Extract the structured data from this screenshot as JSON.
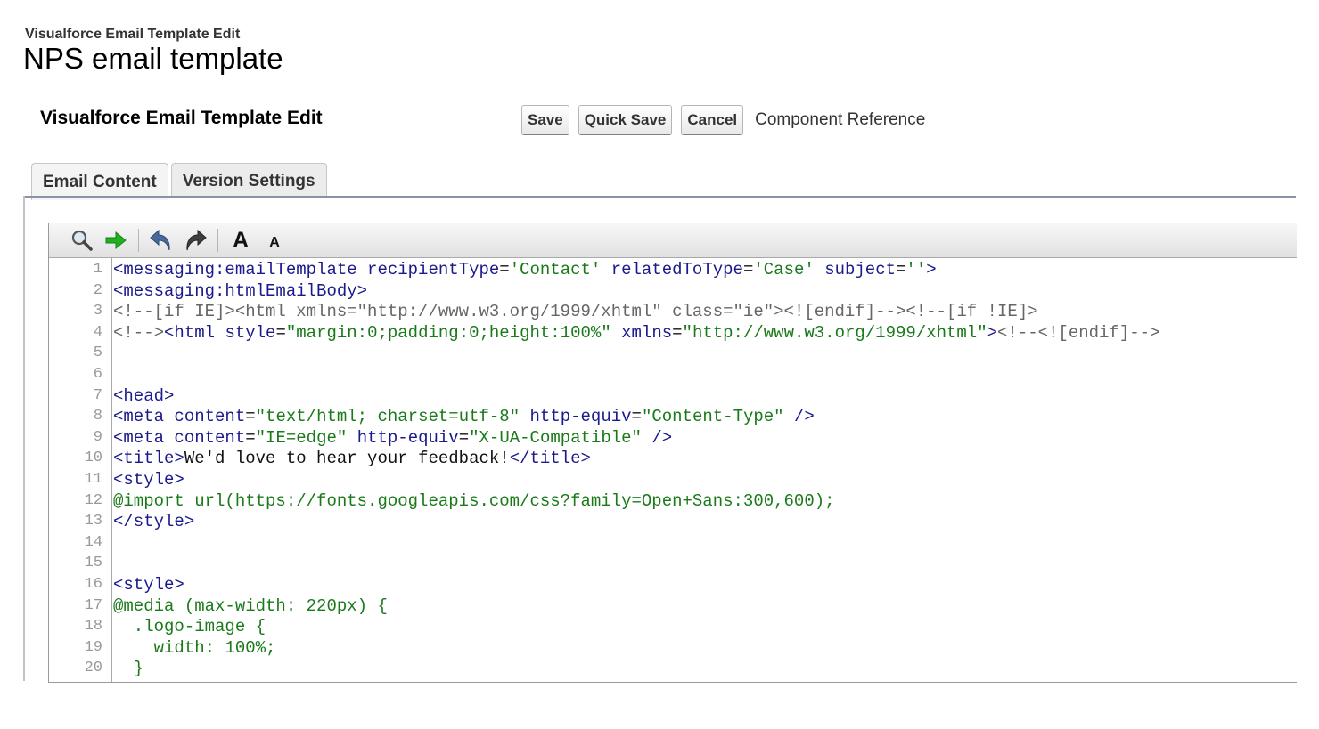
{
  "header": {
    "page_type": "Visualforce Email Template Edit",
    "page_title": "NPS email template",
    "section_title": "Visualforce Email Template Edit"
  },
  "buttons": {
    "save": "Save",
    "quick_save": "Quick Save",
    "cancel": "Cancel",
    "component_reference": "Component Reference"
  },
  "tabs": [
    {
      "label": "Email Content",
      "active": true
    },
    {
      "label": "Version Settings",
      "active": false
    }
  ],
  "toolbar": {
    "icons": [
      "search-icon",
      "go-to-line-icon",
      "undo-icon",
      "redo-icon",
      "increase-font-icon",
      "decrease-font-icon"
    ],
    "increase_font_label": "A",
    "decrease_font_label": "A"
  },
  "colors": {
    "tag": "#1a1a8c",
    "value": "#1a7a1a",
    "comment": "#666666",
    "tab_underline": "#8a93a8"
  },
  "code_lines": [
    {
      "num": "1",
      "segs": [
        [
          "t-tag",
          "<messaging:emailTemplate "
        ],
        [
          "t-att",
          "recipientType"
        ],
        [
          "t-black",
          "="
        ],
        [
          "t-val",
          "'Contact'"
        ],
        [
          "t-black",
          " "
        ],
        [
          "t-att",
          "relatedToType"
        ],
        [
          "t-black",
          "="
        ],
        [
          "t-val",
          "'Case'"
        ],
        [
          "t-black",
          " "
        ],
        [
          "t-att",
          "subject"
        ],
        [
          "t-black",
          "="
        ],
        [
          "t-val",
          "''"
        ],
        [
          "t-tag",
          ">"
        ]
      ]
    },
    {
      "num": "2",
      "segs": [
        [
          "t-tag",
          "<messaging:htmlEmailBody>"
        ]
      ]
    },
    {
      "num": "3",
      "segs": [
        [
          "t-gray",
          "<!--[if IE]><html xmlns=\"http://www.w3.org/1999/xhtml\" class=\"ie\"><![endif]--><!--[if !IE]>"
        ]
      ]
    },
    {
      "num": "4",
      "segs": [
        [
          "t-gray",
          "<!-->"
        ],
        [
          "t-tag",
          "<html "
        ],
        [
          "t-att",
          "style"
        ],
        [
          "t-black",
          "="
        ],
        [
          "t-val",
          "\"margin:0;padding:0;height:100%\""
        ],
        [
          "t-black",
          " "
        ],
        [
          "t-att",
          "xmlns"
        ],
        [
          "t-black",
          "="
        ],
        [
          "t-val",
          "\"http://www.w3.org/1999/xhtml\""
        ],
        [
          "t-tag",
          ">"
        ],
        [
          "t-gray",
          "<!--<![endif]-->"
        ]
      ]
    },
    {
      "num": "5",
      "segs": []
    },
    {
      "num": "6",
      "segs": []
    },
    {
      "num": "7",
      "segs": [
        [
          "t-tag",
          "<head>"
        ]
      ]
    },
    {
      "num": "8",
      "segs": [
        [
          "t-tag",
          "<meta "
        ],
        [
          "t-att",
          "content"
        ],
        [
          "t-black",
          "="
        ],
        [
          "t-val",
          "\"text/html; charset=utf-8\""
        ],
        [
          "t-black",
          " "
        ],
        [
          "t-att",
          "http-equiv"
        ],
        [
          "t-black",
          "="
        ],
        [
          "t-val",
          "\"Content-Type\""
        ],
        [
          "t-black",
          " "
        ],
        [
          "t-tag",
          "/>"
        ]
      ]
    },
    {
      "num": "9",
      "segs": [
        [
          "t-tag",
          "<meta "
        ],
        [
          "t-att",
          "content"
        ],
        [
          "t-black",
          "="
        ],
        [
          "t-val",
          "\"IE=edge\""
        ],
        [
          "t-black",
          " "
        ],
        [
          "t-att",
          "http-equiv"
        ],
        [
          "t-black",
          "="
        ],
        [
          "t-val",
          "\"X-UA-Compatible\""
        ],
        [
          "t-black",
          " "
        ],
        [
          "t-tag",
          "/>"
        ]
      ]
    },
    {
      "num": "10",
      "segs": [
        [
          "t-tag",
          "<title>"
        ],
        [
          "t-black",
          "We'd love to hear your feedback!"
        ],
        [
          "t-tag",
          "</title>"
        ]
      ]
    },
    {
      "num": "11",
      "segs": [
        [
          "t-tag",
          "<style>"
        ]
      ]
    },
    {
      "num": "12",
      "segs": [
        [
          "t-green",
          "@import url(https://fonts.googleapis.com/css?family=Open+Sans:300,600);"
        ]
      ]
    },
    {
      "num": "13",
      "segs": [
        [
          "t-tag",
          "</style>"
        ]
      ]
    },
    {
      "num": "14",
      "segs": []
    },
    {
      "num": "15",
      "segs": []
    },
    {
      "num": "16",
      "segs": [
        [
          "t-tag",
          "<style>"
        ]
      ]
    },
    {
      "num": "17",
      "segs": [
        [
          "t-green",
          "@media (max-width: 220px) {"
        ]
      ]
    },
    {
      "num": "18",
      "segs": [
        [
          "t-green",
          "  .logo-image {"
        ]
      ]
    },
    {
      "num": "19",
      "segs": [
        [
          "t-green",
          "    width: 100%;"
        ]
      ]
    },
    {
      "num": "20",
      "segs": [
        [
          "t-green",
          "  }"
        ]
      ]
    }
  ]
}
